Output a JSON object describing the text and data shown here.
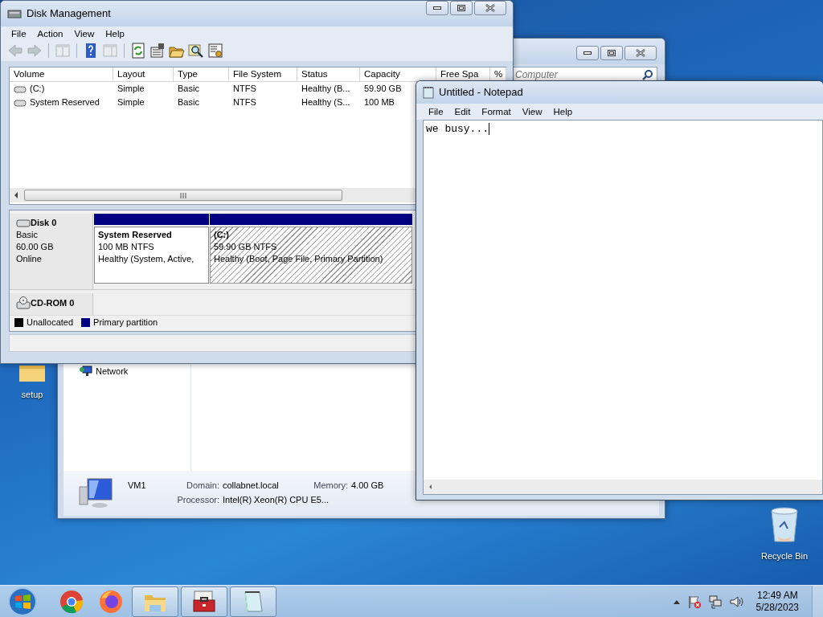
{
  "desktop_icons": [
    {
      "kind": "folder",
      "label": "setup"
    },
    {
      "kind": "recycle",
      "label": "Recycle Bin"
    }
  ],
  "explorer_window": {
    "search": {
      "placeholder": "Computer"
    },
    "nav_items": [
      {
        "label": "Network"
      }
    ],
    "details": {
      "name": "VM1",
      "fields": [
        {
          "label": "Domain:",
          "value": "collabnet.local"
        },
        {
          "label": "Memory:",
          "value": "4.00 GB"
        },
        {
          "label": "Processor:",
          "value": "Intel(R) Xeon(R) CPU E5..."
        }
      ]
    }
  },
  "disk_management": {
    "title": "Disk Management",
    "menu": [
      "File",
      "Action",
      "View",
      "Help"
    ],
    "toolbar": [
      {
        "kind": "back",
        "disabled": true
      },
      {
        "kind": "forward",
        "disabled": true
      },
      {
        "kind": "console",
        "disabled": true
      },
      {
        "kind": "help",
        "disabled": false
      },
      {
        "kind": "action-pane",
        "disabled": true
      },
      {
        "kind": "refresh",
        "disabled": false
      },
      {
        "kind": "properties",
        "disabled": false
      },
      {
        "kind": "open",
        "disabled": false
      },
      {
        "kind": "explore",
        "disabled": false
      },
      {
        "kind": "settings",
        "disabled": false
      }
    ],
    "volume_table": {
      "columns": [
        "Volume",
        "Layout",
        "Type",
        "File System",
        "Status",
        "Capacity",
        "Free Spa",
        "%"
      ],
      "rows": [
        {
          "kind": "drive",
          "cells": [
            "(C:)",
            "Simple",
            "Basic",
            "NTFS",
            "Healthy (B...",
            "59.90 GB"
          ]
        },
        {
          "kind": "drive",
          "cells": [
            "System Reserved",
            "Simple",
            "Basic",
            "NTFS",
            "Healthy (S...",
            "100 MB"
          ]
        }
      ]
    },
    "disks": [
      {
        "kind": "disk",
        "name": "Disk 0",
        "info": [
          "Basic",
          "60.00 GB",
          "Online"
        ],
        "partitions": [
          {
            "name": "System Reserved",
            "size": "100 MB NTFS",
            "status": "Healthy (System, Active,",
            "selected": false
          },
          {
            "name": "(C:)",
            "size": "59.90 GB NTFS",
            "status": "Healthy (Boot, Page File, Primary Partition)",
            "selected": true
          }
        ]
      },
      {
        "kind": "cdrom",
        "name": "CD-ROM 0"
      }
    ],
    "legend": [
      {
        "label": "Unallocated",
        "color": "#000000"
      },
      {
        "label": "Primary partition",
        "color": "#000080"
      }
    ]
  },
  "notepad": {
    "title": "Untitled - Notepad",
    "menu": [
      "File",
      "Edit",
      "Format",
      "View",
      "Help"
    ],
    "text": "we busy..."
  },
  "taskbar": {
    "apps": [
      {
        "kind": "chrome",
        "running": false
      },
      {
        "kind": "firefox",
        "running": false
      },
      {
        "kind": "explorer",
        "running": true
      },
      {
        "kind": "toolbox",
        "running": true
      },
      {
        "kind": "notepad",
        "running": true
      }
    ],
    "clock": {
      "time": "12:49 AM",
      "date": "5/28/2023"
    }
  }
}
